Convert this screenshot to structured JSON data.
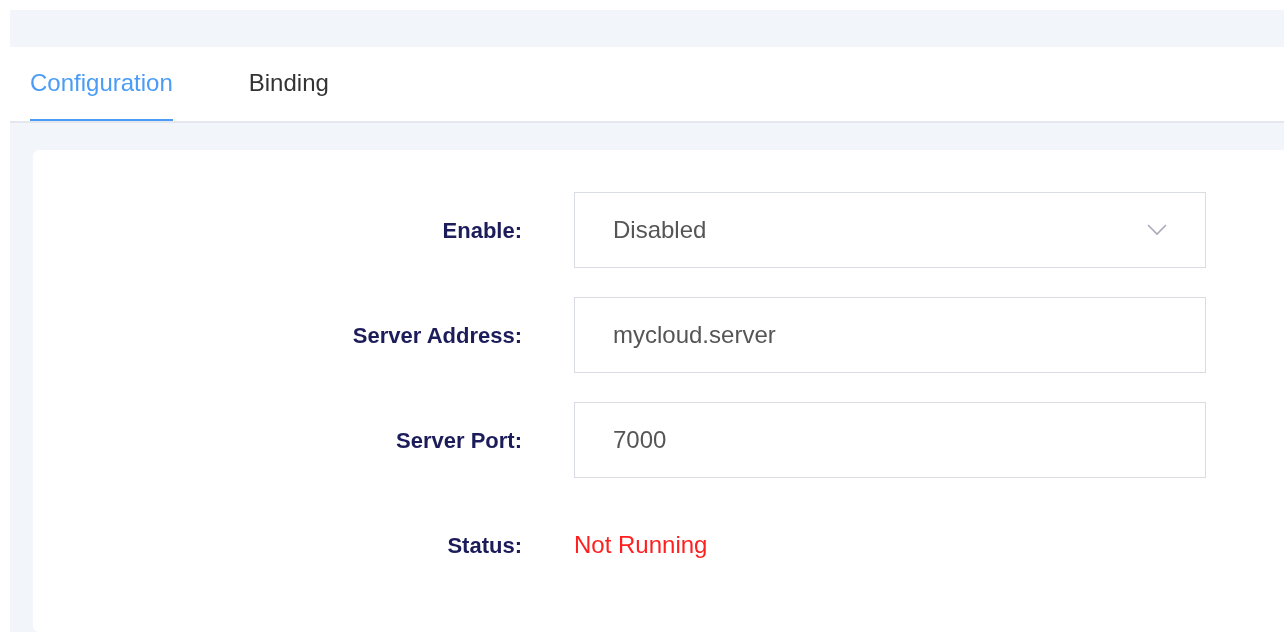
{
  "tabs": [
    {
      "label": "Configuration",
      "selected": true
    },
    {
      "label": "Binding",
      "selected": false
    }
  ],
  "form": {
    "fields": [
      {
        "kind": "select",
        "label": "Enable:",
        "value": "Disabled"
      },
      {
        "kind": "text",
        "label": "Server Address:",
        "value": "mycloud.server"
      },
      {
        "kind": "text",
        "label": "Server Port:",
        "value": "7000"
      }
    ],
    "status": {
      "label": "Status:",
      "value": "Not Running",
      "running": false
    }
  }
}
